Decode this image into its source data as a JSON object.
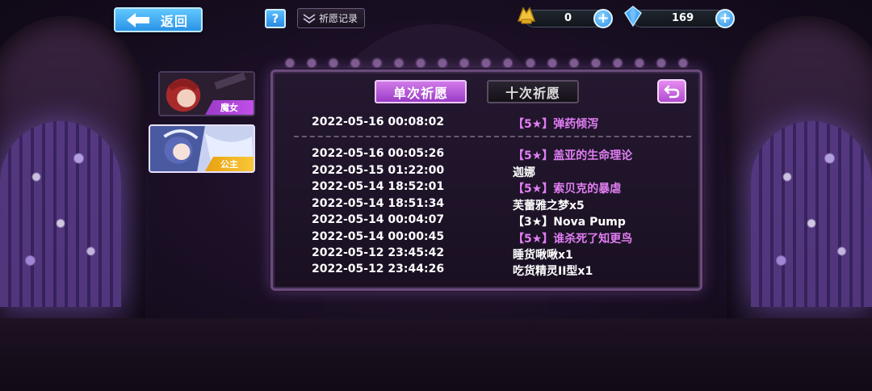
{
  "top_bar": {
    "back_label": "返回",
    "help_label": "?",
    "record_label": "祈愿记录"
  },
  "resources": {
    "gold": {
      "icon": "gold-wing-icon",
      "value": "0"
    },
    "crystal": {
      "icon": "crystal-icon",
      "value": "169"
    }
  },
  "characters": [
    {
      "name": "魔女",
      "active": false
    },
    {
      "name": "公主",
      "active": true
    }
  ],
  "panel": {
    "tabs": [
      {
        "label": "单次祈愿",
        "active": true
      },
      {
        "label": "十次祈愿",
        "active": false
      }
    ],
    "first_record": {
      "time": "2022-05-16 00:08:02",
      "item": "【5★】弹药倾泻",
      "rarity": 5
    },
    "records": [
      {
        "time": "2022-05-16 00:05:26",
        "item": "【5★】盖亚的生命理论",
        "rarity": 5
      },
      {
        "time": "2022-05-15 01:22:00",
        "item": "迦娜",
        "rarity": 0
      },
      {
        "time": "2022-05-14 18:52:01",
        "item": "【5★】索贝克的暴虐",
        "rarity": 5
      },
      {
        "time": "2022-05-14 18:51:34",
        "item": "芙蕾雅之梦x5",
        "rarity": 0
      },
      {
        "time": "2022-05-14 00:04:07",
        "item": "【3★】Nova Pump",
        "rarity": 3
      },
      {
        "time": "2022-05-14 00:00:45",
        "item": "【5★】谁杀死了知更鸟",
        "rarity": 5
      },
      {
        "time": "2022-05-12 23:45:42",
        "item": "睡货啾啾x1",
        "rarity": 0
      },
      {
        "time": "2022-05-12 23:44:26",
        "item": "吃货精灵II型x1",
        "rarity": 0
      }
    ]
  },
  "colors": {
    "five_star": "#e07ef2",
    "accent_blue": "#2a93e6",
    "tab_active": "#b04cd0"
  }
}
